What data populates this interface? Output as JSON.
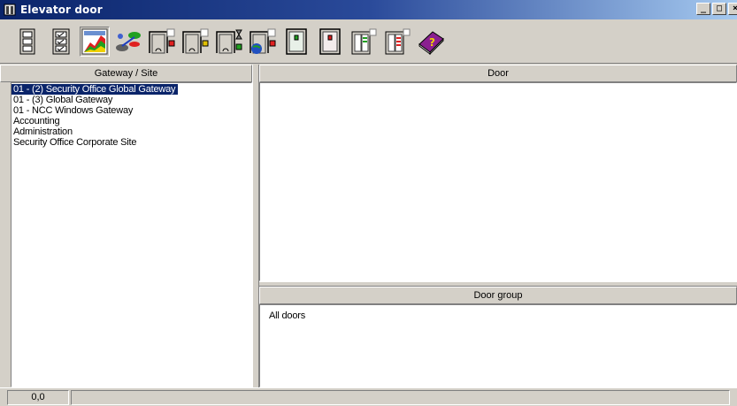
{
  "window": {
    "title": "Elevator door",
    "icon": "elevator-door-icon",
    "controls": {
      "minimize": "_",
      "maximize": "□",
      "close": "×"
    },
    "title_gradient": [
      "#0a246a",
      "#a6caf0"
    ]
  },
  "toolbar": {
    "buttons": [
      {
        "icon": "panel-stack-icon"
      },
      {
        "icon": "checklist-icon"
      },
      {
        "icon": "chart-icon",
        "pressed": true
      },
      {
        "icon": "network-link-icon"
      },
      {
        "icon": "door-red-indicator-icon"
      },
      {
        "icon": "door-lock-indicator-icon"
      },
      {
        "icon": "door-timer-icon"
      },
      {
        "icon": "door-globe-icon"
      },
      {
        "icon": "green-light-panel-icon"
      },
      {
        "icon": "red-light-panel-icon"
      },
      {
        "icon": "cabinet-green-icon"
      },
      {
        "icon": "cabinet-red-icon"
      },
      {
        "icon": "help-book-icon"
      }
    ]
  },
  "gateway_panel": {
    "header": "Gateway / Site",
    "items": [
      {
        "label": "01 - (2)  Security Office Global Gateway",
        "selected": true
      },
      {
        "label": "01 - (3)  Global Gateway",
        "selected": false
      },
      {
        "label": "01 - NCC Windows Gateway",
        "selected": false
      },
      {
        "label": "Accounting",
        "selected": false
      },
      {
        "label": "Administration",
        "selected": false
      },
      {
        "label": "Security Office Corporate Site",
        "selected": false
      }
    ]
  },
  "door_panel": {
    "header": "Door",
    "items": []
  },
  "door_group_panel": {
    "header": "Door group",
    "items": [
      {
        "label": "All doors"
      }
    ]
  },
  "statusbar": {
    "position": "0,0"
  },
  "colors": {
    "selection": "#0a246a",
    "face": "#d4d0c8"
  }
}
